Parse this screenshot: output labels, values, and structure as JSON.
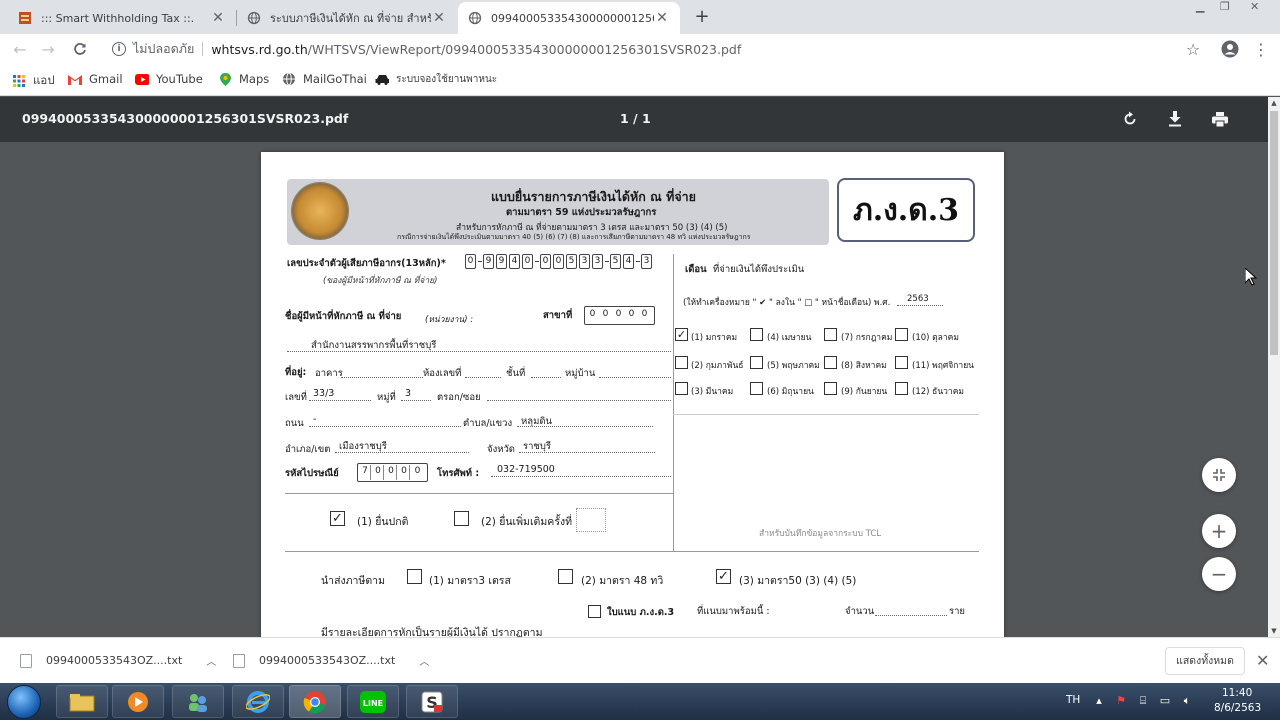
{
  "tabs": [
    {
      "title": "::: Smart Withholding Tax ::.",
      "active": false
    },
    {
      "title": "ระบบภาษีเงินได้หัก ณ ที่จ่าย สำหรับผู้เ",
      "active": false
    },
    {
      "title": "099400053354300000001256301",
      "active": true
    }
  ],
  "toolbar": {
    "security_label": "ไม่ปลอดภัย",
    "url_host": "whtsvs.rd.go.th",
    "url_path": "/WHTSVS/ViewReport/099400053354300000001256301SVSR023.pdf"
  },
  "bookmarks": [
    {
      "label": "แอป",
      "icon": "apps-grid-icon"
    },
    {
      "label": "Gmail",
      "icon": "gmail-icon"
    },
    {
      "label": "YouTube",
      "icon": "youtube-icon"
    },
    {
      "label": "Maps",
      "icon": "maps-icon"
    },
    {
      "label": "MailGoThai",
      "icon": "globe-icon"
    },
    {
      "label": "ระบบจองใช้ยานพาหนะ",
      "icon": "car-icon"
    }
  ],
  "viewer": {
    "filename": "099400053354300000001256301SVSR023.pdf",
    "page_indicator": "1 / 1"
  },
  "form": {
    "title_line1": "แบบยื่นรายการภาษีเงินได้หัก ณ ที่จ่าย",
    "title_line2": "ตามมาตรา 59 แห่งประมวลรัษฎากร",
    "title_line3": "สำหรับการหักภาษี ณ ที่จ่ายตามมาตรา 3 เตรส และมาตรา 50 (3) (4) (5)",
    "title_line4": "กรณีการจ่ายเงินได้พึงประเมินตามมาตรา 40 (5) (6) (7) (8) และการเสียภาษีตามมาตรา 48 ทวิ แห่งประมวลรัษฎากร",
    "form_code": "ภ.ง.ด.3",
    "taxid_label": "เลขประจำตัวผู้เสียภาษีอากร(13หลัก)*",
    "taxid_sub": "(ของผู้มีหน้าที่หักภาษี ณ ที่จ่าย)",
    "taxid_digits": [
      "0",
      "9",
      "9",
      "4",
      "0",
      "0",
      "0",
      "5",
      "3",
      "3",
      "5",
      "4",
      "3"
    ],
    "payer_label": "ชื่อผู้มีหน้าที่หักภาษี ณ ที่จ่าย",
    "payer_unit": "(หน่วยงาน) :",
    "branch_label": "สาขาที่",
    "branch_digits": [
      "0",
      "0",
      "0",
      "0",
      "0"
    ],
    "payer_name": "สำนักงานสรรพากรพื้นที่ราชบุรี",
    "addr_label": "ที่อยู่:",
    "building_label": "อาคาร",
    "room_label": "ห้องเลขที่",
    "floor_label": "ชั้นที่",
    "village_label": "หมู่บ้าน",
    "no_label": "เลขที่",
    "no_value": "33/3",
    "moo_label": "หมู่ที่",
    "moo_value": "3",
    "soi_label": "ตรอก/ซอย",
    "road_label": "ถนน",
    "road_value": "-",
    "subdistrict_label": "ตำบล/แขวง",
    "subdistrict_value": "หลุมดิน",
    "district_label": "อำเภอ/เขต",
    "district_value": "เมืองราชบุรี",
    "province_label": "จังหวัด",
    "province_value": "ราชบุรี",
    "postcode_label": "รหัสไปรษณีย์",
    "postcode_digits": [
      "7",
      "0",
      "0",
      "0",
      "0"
    ],
    "phone_label": "โทรศัพท์ :",
    "phone_value": "032-719500",
    "month_label": "เดือน",
    "month_sub": "ที่จ่ายเงินได้พึงประเมิน",
    "month_hint": "(ให้ทำเครื่องหมาย \" ✔ \" ลงใน \" □ \" หน้าชื่อเดือน) พ.ศ.",
    "year_value": "2563",
    "months": [
      {
        "label": "(1) มกราคม",
        "checked": true
      },
      {
        "label": "(4) เมษายน",
        "checked": false
      },
      {
        "label": "(7) กรกฎาคม",
        "checked": false
      },
      {
        "label": "(10) ตุลาคม",
        "checked": false
      },
      {
        "label": "(2) กุมภาพันธ์",
        "checked": false
      },
      {
        "label": "(5) พฤษภาคม",
        "checked": false
      },
      {
        "label": "(8) สิงหาคม",
        "checked": false
      },
      {
        "label": "(11) พฤศจิกายน",
        "checked": false
      },
      {
        "label": "(3) มีนาคม",
        "checked": false
      },
      {
        "label": "(6) มิถุนายน",
        "checked": false
      },
      {
        "label": "(9) กันยายน",
        "checked": false
      },
      {
        "label": "(12) ธันวาคม",
        "checked": false
      }
    ],
    "tcl_note": "สำหรับบันทึกข้อมูลจากระบบ TCL",
    "filing_normal": "(1) ยื่นปกติ",
    "filing_additional": "(2) ยื่นเพิ่มเติมครั้งที่",
    "remit_label": "นำส่งภาษีตาม",
    "remit_1": "(1) มาตรา3 เตรส",
    "remit_2": "(2) มาตรา 48 ทวิ",
    "remit_3": "(3) มาตรา50 (3) (4) (5)",
    "attach_form": "ใบแนบ  ภ.ง.ด.3",
    "attach_with": "ที่แนบมาพร้อมนี้ :",
    "count_label": "จำนวน",
    "unit_label": "ราย",
    "details_label": "มีรายละเอียดการหักเป็นรายผู้มีเงินได้ ปรากฏตาม"
  },
  "downloads": [
    {
      "name": "0994000533543OZ....txt"
    },
    {
      "name": "0994000533543OZ....txt"
    }
  ],
  "shelf": {
    "show_all": "แสดงทั้งหมด"
  },
  "taskbar": {
    "lang": "TH",
    "time": "11:40",
    "date": "8/6/2563"
  }
}
